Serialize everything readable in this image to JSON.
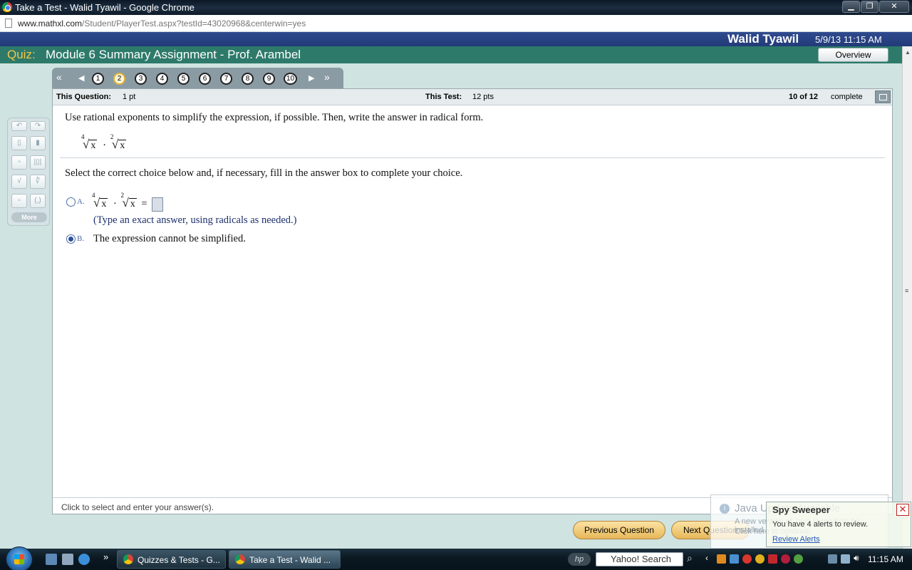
{
  "window": {
    "title": "Take a Test - Walid Tyawil - Google Chrome",
    "minimize": "▁",
    "maximize": "❐",
    "close": "✕"
  },
  "address": {
    "domain": "www.mathxl.com",
    "path": "/Student/PlayerTest.aspx?testId=43020968&centerwin=yes"
  },
  "header": {
    "user_name": "Walid Tyawil",
    "datetime": "5/9/13 11:15 AM",
    "quiz_label": "Quiz:",
    "quiz_title": "Module 6 Summary Assignment - Prof. Arambel",
    "overview_button": "Overview"
  },
  "question_nav": {
    "first": "«",
    "prev": "◀",
    "next": "▶",
    "last": "»",
    "numbers": [
      "1",
      "2",
      "3",
      "4",
      "5",
      "6",
      "7",
      "8",
      "9",
      "10"
    ],
    "current": 2
  },
  "info_bar": {
    "this_question_label": "This Question:",
    "this_question_value": "1 pt",
    "this_test_label": "This Test:",
    "this_test_value": "12 pts",
    "progress": "10 of 12",
    "progress_status": "complete"
  },
  "question": {
    "instruction": "Use rational exponents to simplify the expression, if possible. Then, write the answer in radical form.",
    "expr_index1": "4",
    "expr_index2": "2",
    "radicand": "x",
    "dot": "·",
    "equals": "=",
    "select_instruction": "Select the correct choice below and, if necessary, fill in the answer box to complete your choice.",
    "choice_a_letter": "A.",
    "choice_a_hint": "(Type an exact answer, using radicals as needed.)",
    "choice_b_letter": "B.",
    "choice_b_text": "The expression cannot be simplified.",
    "selected_choice": "B"
  },
  "status_bar": {
    "text": "Click to select and enter your answer(s)."
  },
  "palette": {
    "more": "More"
  },
  "footer": {
    "previous_button": "Previous Question",
    "next_button": "Next Question"
  },
  "notifications": {
    "java_title": "Java Update Available",
    "java_line1": "A new version of Java is ready to be installed.",
    "java_line2": "Click here to continue.",
    "spy_title": "Spy Sweeper",
    "spy_body": "You have 4 alerts to review.",
    "spy_link": "Review Alerts"
  },
  "taskbar": {
    "task1": "Quizzes & Tests - G...",
    "task2": "Take a Test - Walid ...",
    "search_label": "Yahoo! Search",
    "hp": "hp",
    "clock": "11:15 AM"
  },
  "colors": {
    "header_blue": "#2f4b8e",
    "quiz_green": "#2d7a6a",
    "quiz_label_gold": "#f4c64a",
    "button_gold": "#e7b75a"
  }
}
